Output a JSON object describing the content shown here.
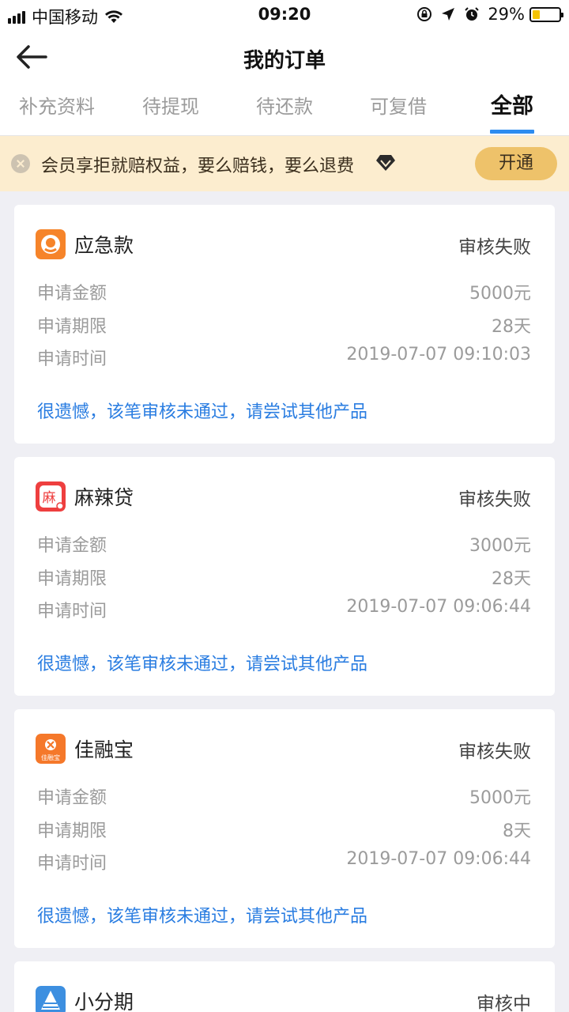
{
  "status_bar": {
    "carrier": "中国移动",
    "time": "09:20",
    "battery": "29%",
    "battery_level": 0.29
  },
  "nav": {
    "title": "我的订单",
    "back_icon": "arrow-left-icon"
  },
  "tabs": [
    {
      "label": "补充资料",
      "active": false
    },
    {
      "label": "待提现",
      "active": false
    },
    {
      "label": "待还款",
      "active": false
    },
    {
      "label": "可复借",
      "active": false
    },
    {
      "label": "全部",
      "active": true
    }
  ],
  "banner": {
    "text": "会员享拒就赔权益，要么赔钱，要么退费",
    "button": "开通"
  },
  "orders": [
    {
      "name": "应急款",
      "status": "审核失败",
      "rows": [
        {
          "label": "申请金额",
          "value": "5000元"
        },
        {
          "label": "申请期限",
          "value": "28天"
        },
        {
          "label": "申请时间",
          "value": "2019-07-07 09:10:03"
        }
      ],
      "notice": "很遗憾，该笔审核未通过，请尝试其他产品"
    },
    {
      "name": "麻辣贷",
      "status": "审核失败",
      "logo_text": "麻",
      "rows": [
        {
          "label": "申请金额",
          "value": "3000元"
        },
        {
          "label": "申请期限",
          "value": "28天"
        },
        {
          "label": "申请时间",
          "value": "2019-07-07 09:06:44"
        }
      ],
      "notice": "很遗憾，该笔审核未通过，请尝试其他产品"
    },
    {
      "name": "佳融宝",
      "status": "审核失败",
      "logo_text": "佳融宝",
      "rows": [
        {
          "label": "申请金额",
          "value": "5000元"
        },
        {
          "label": "申请期限",
          "value": "8天"
        },
        {
          "label": "申请时间",
          "value": "2019-07-07 09:06:44"
        }
      ],
      "notice": "很遗憾，该笔审核未通过，请尝试其他产品"
    },
    {
      "name": "小分期",
      "status": "审核中"
    }
  ],
  "colors": {
    "accent": "#2d8cf0",
    "notice_blue": "#2a7de1",
    "banner_bg": "#fcedcf",
    "banner_button": "#eec26a"
  }
}
